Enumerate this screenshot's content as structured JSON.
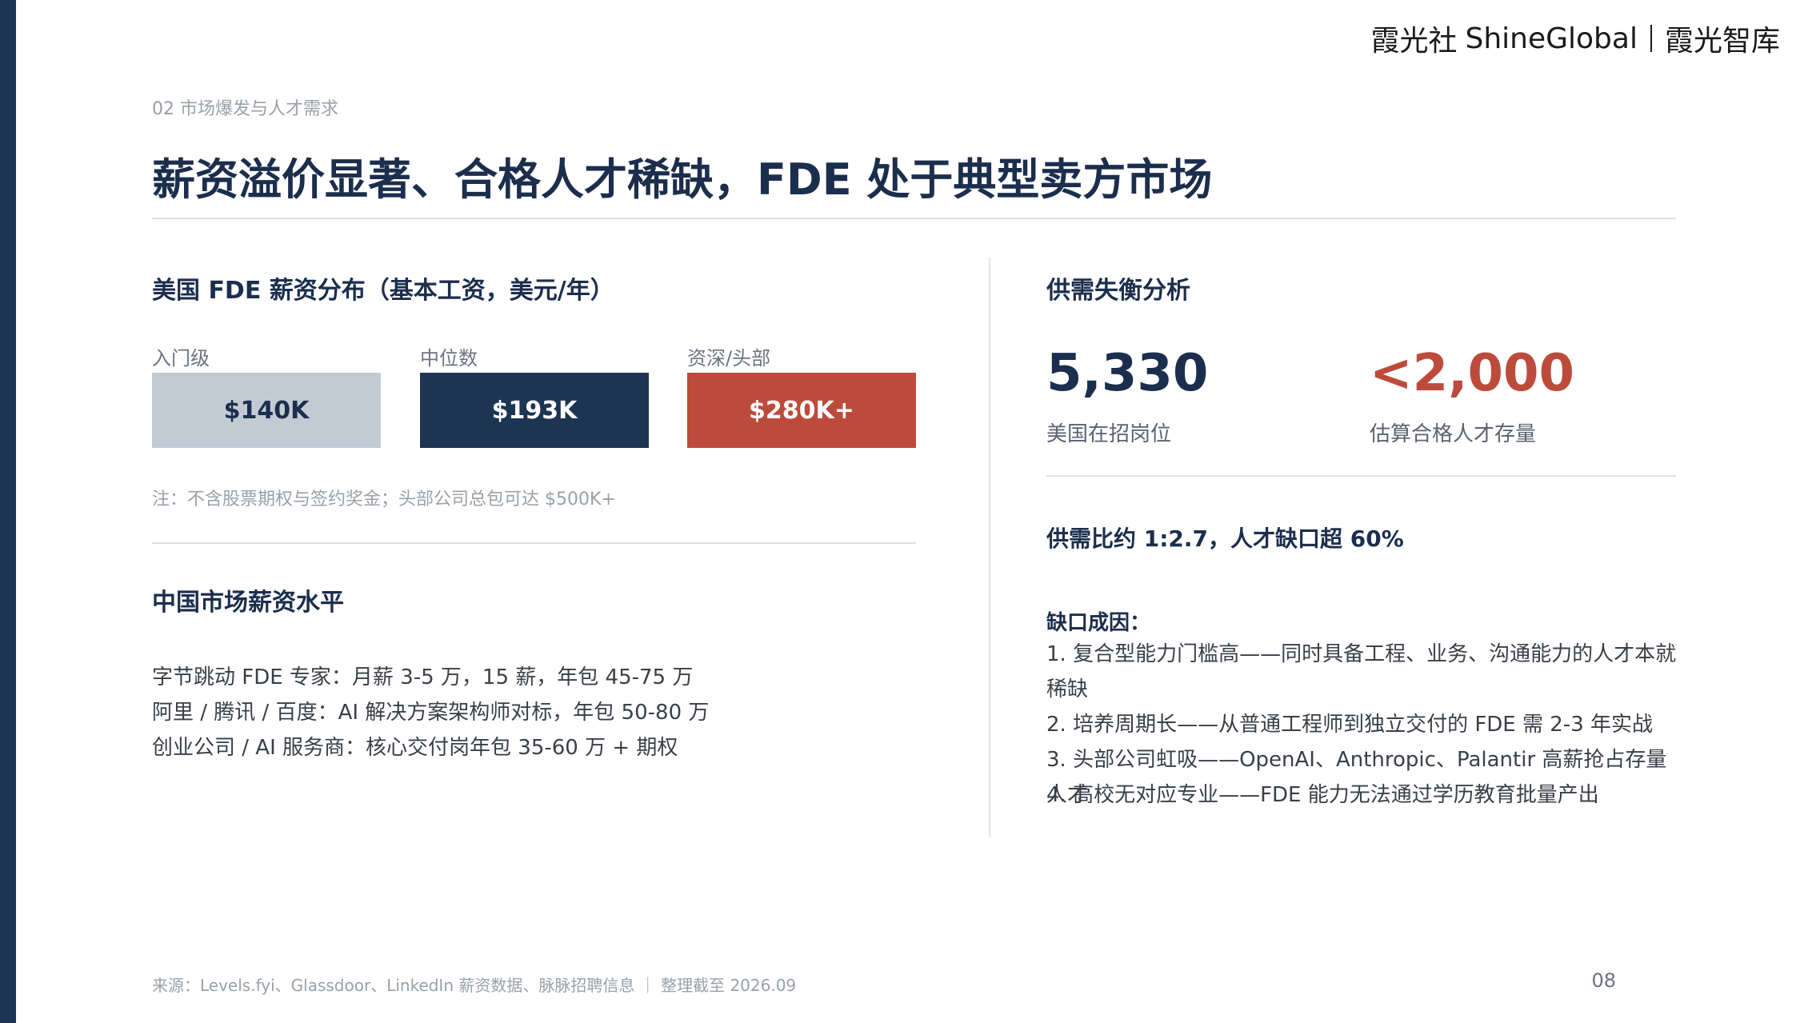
{
  "brand": {
    "name_cn": "霞光社",
    "name_en": "ShineGlobal",
    "sub": "霞光智库"
  },
  "kicker": "02 市场爆发与人才需求",
  "title": "薪资溢价显著、合格人才稀缺，FDE 处于典型卖方市场",
  "us_salary": {
    "title": "美国 FDE 薪资分布（基本工资，美元/年）",
    "tiers": [
      {
        "label": "入门级",
        "value": "$140K",
        "bg": "#c2cbd4",
        "fg": "#1c2e4d"
      },
      {
        "label": "中位数",
        "value": "$193K",
        "bg": "#1d3553",
        "fg": "#ffffff"
      },
      {
        "label": "资深/头部",
        "value": "$280K+",
        "bg": "#bd4b3b",
        "fg": "#ffffff"
      }
    ],
    "note": "注：不含股票期权与签约奖金；头部公司总包可达 $500K+"
  },
  "china_salary": {
    "title": "中国市场薪资水平",
    "lines": [
      "字节跳动 FDE 专家：月薪 3-5 万，15 薪，年包 45-75 万",
      "阿里 / 腾讯 / 百度：AI 解决方案架构师对标，年包 50-80 万",
      "创业公司 / AI 服务商：核心交付岗年包 35-60 万 + 期权"
    ]
  },
  "supply_demand": {
    "title": "供需失衡分析",
    "stats": [
      {
        "value": "5,330",
        "caption": "美国在招岗位",
        "color": "#1c2e4d"
      },
      {
        "value": "<2,000",
        "caption": "估算合格人才存量",
        "color": "#bd4b3b"
      }
    ],
    "ratio": "供需比约 1:2.7，人才缺口超 60%",
    "causes_title": "缺口成因：",
    "causes": [
      "1. 复合型能力门槛高——同时具备工程、业务、沟通能力的人才本就稀缺",
      "2. 培养周期长——从普通工程师到独立交付的 FDE 需 2-3 年实战",
      "3. 头部公司虹吸——OpenAI、Anthropic、Palantir 高薪抢占存量人才",
      "4. 高校无对应专业——FDE 能力无法通过学历教育批量产出"
    ]
  },
  "footer": {
    "source": "来源：Levels.fyi、Glassdoor、LinkedIn 薪资数据、脉脉招聘信息 ｜ 整理截至 2026.09",
    "page": "08"
  }
}
